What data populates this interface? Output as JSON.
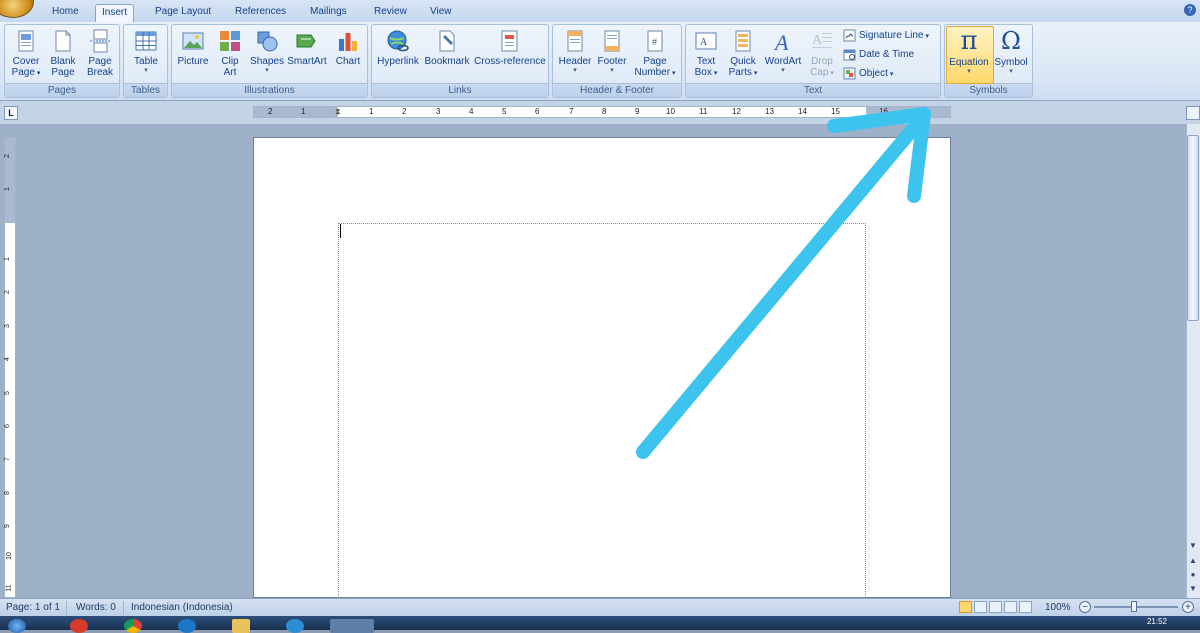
{
  "tabs": [
    "Home",
    "Insert",
    "Page Layout",
    "References",
    "Mailings",
    "Review",
    "View"
  ],
  "active_tab": "Insert",
  "groups": {
    "pages": {
      "label": "Pages",
      "buttons": [
        {
          "line1": "Cover",
          "line2": "Page"
        },
        {
          "line1": "Blank",
          "line2": "Page"
        },
        {
          "line1": "Page",
          "line2": "Break"
        }
      ]
    },
    "tables": {
      "label": "Tables",
      "buttons": [
        {
          "line1": "Table",
          "line2": ""
        }
      ]
    },
    "illustrations": {
      "label": "Illustrations",
      "buttons": [
        {
          "line1": "Picture",
          "line2": ""
        },
        {
          "line1": "Clip",
          "line2": "Art"
        },
        {
          "line1": "Shapes",
          "line2": ""
        },
        {
          "line1": "SmartArt",
          "line2": ""
        },
        {
          "line1": "Chart",
          "line2": ""
        }
      ]
    },
    "links": {
      "label": "Links",
      "buttons": [
        {
          "line1": "Hyperlink",
          "line2": ""
        },
        {
          "line1": "Bookmark",
          "line2": ""
        },
        {
          "line1": "Cross-reference",
          "line2": ""
        }
      ]
    },
    "header_footer": {
      "label": "Header & Footer",
      "buttons": [
        {
          "line1": "Header",
          "line2": ""
        },
        {
          "line1": "Footer",
          "line2": ""
        },
        {
          "line1": "Page",
          "line2": "Number"
        }
      ]
    },
    "text": {
      "label": "Text",
      "buttons": [
        {
          "line1": "Text",
          "line2": "Box"
        },
        {
          "line1": "Quick",
          "line2": "Parts"
        },
        {
          "line1": "WordArt",
          "line2": ""
        },
        {
          "line1": "Drop",
          "line2": "Cap"
        }
      ],
      "small": [
        "Signature Line",
        "Date & Time",
        "Object"
      ]
    },
    "symbols": {
      "label": "Symbols",
      "buttons": [
        {
          "line1": "Equation",
          "line2": ""
        },
        {
          "line1": "Symbol",
          "line2": ""
        }
      ],
      "glyphs": [
        "π",
        "Ω"
      ]
    }
  },
  "ruler": {
    "tab_selector": "L",
    "h_numbers": [
      "2",
      "1",
      "1",
      "1",
      "2",
      "3",
      "4",
      "5",
      "6",
      "7",
      "8",
      "9",
      "10",
      "11",
      "12",
      "13",
      "14",
      "15",
      "16"
    ],
    "v_numbers": [
      "2",
      "1",
      "1",
      "1",
      "2",
      "3",
      "4",
      "5",
      "6",
      "7",
      "8",
      "9",
      "10",
      "11"
    ]
  },
  "status": {
    "page": "Page: 1 of 1",
    "words": "Words: 0",
    "language": "Indonesian (Indonesia)",
    "zoom": "100%"
  },
  "taskbar": {
    "clock": "21:52"
  },
  "colors": {
    "arrow": "#3cc4ef",
    "ribbon_accent": "#15428b",
    "equation_highlight": "#ffd86b"
  }
}
